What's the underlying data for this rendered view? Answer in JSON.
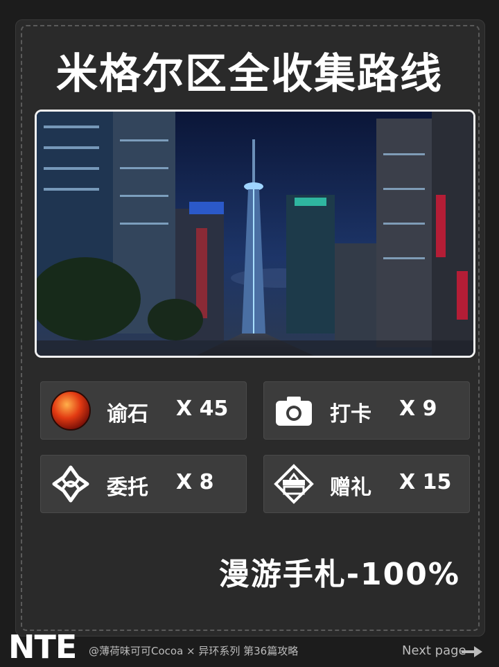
{
  "title": "米格尔区全收集路线",
  "stats": [
    {
      "icon": "red-orb-icon",
      "label": "谕石",
      "count": "X 45"
    },
    {
      "icon": "camera-icon",
      "label": "打卡",
      "count": "X 9"
    },
    {
      "icon": "knot-emblem-icon",
      "label": "委托",
      "count": "X 8"
    },
    {
      "icon": "gift-emblem-icon",
      "label": "赠礼",
      "count": "X 15"
    }
  ],
  "roaming": "漫游手札-100%",
  "footer": {
    "logo": "NTE",
    "credit": "@薄荷味可可Cocoa × 异环系列 第36篇攻略",
    "next": "Next page"
  },
  "colors": {
    "background": "#1c1c1c",
    "card": "#2a2a2a",
    "tile": "#3c3c3c",
    "text": "#ffffff"
  }
}
